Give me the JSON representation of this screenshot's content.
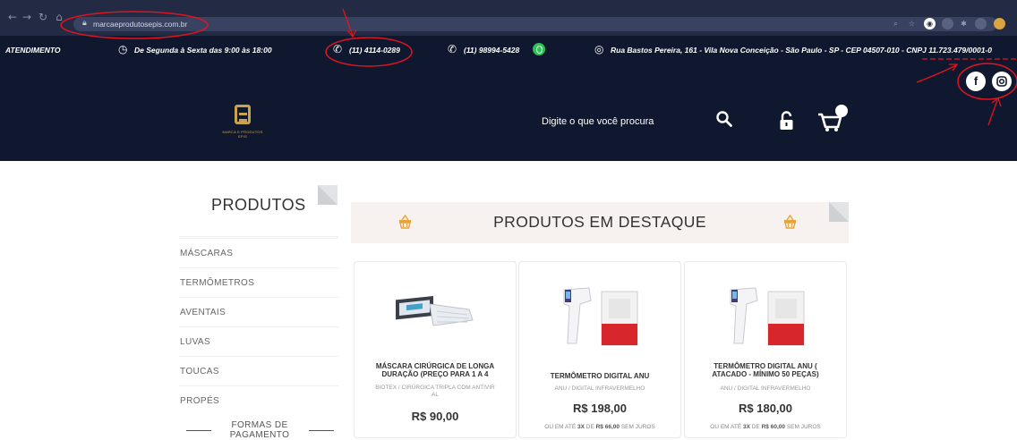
{
  "browser": {
    "url": "marcaeprodutosepis.com.br"
  },
  "infobar": {
    "atendimento_label": "ATENDIMENTO",
    "hours": "De Segunda à Sexta das 9:00 às 18:00",
    "phone1": "(11) 4114-0289",
    "phone2": "(11) 98994-5428",
    "address": "Rua Bastos Pereira, 161 - Vila Nova Conceição - São Paulo - SP - CEP 04507-010 - CNPJ 11.723.479/0001-0"
  },
  "header": {
    "logo_text": "MARCA E PRODUTOS EPIS",
    "search_placeholder": "Digite o que você procura",
    "social": {
      "facebook": "f"
    }
  },
  "sidebar": {
    "title": "PRODUTOS",
    "items": [
      "MÁSCARAS",
      "TERMÔMETROS",
      "AVENTAIS",
      "LUVAS",
      "TOUCAS",
      "PROPÉS"
    ],
    "formas_pagamento_line1": "FORMAS DE",
    "formas_pagamento_line2": "PAGAMENTO"
  },
  "featured": {
    "title": "PRODUTOS EM DESTAQUE"
  },
  "products": [
    {
      "name_line1": "MÁSCARA CIRÚRGICA DE LONGA",
      "name_line2": "DURAÇÃO (PREÇO PARA 1 A 4",
      "category_line1": "BIOTEX / CIRÚRGICA TRIPLA COM ANTIVIR",
      "category_line2": "AL",
      "price": "R$ 90,00"
    },
    {
      "name_line1": "TERMÔMETRO DIGITAL ANU",
      "category_line1": "ANU / DIGITAL INFRAVERMELHO",
      "price": "R$ 198,00",
      "installment_prefix": "OU EM ATÉ",
      "installment_count": "3X",
      "installment_mid": "DE",
      "installment_value": "R$ 66,00",
      "installment_suffix": "SEM JUROS"
    },
    {
      "name_line1": "TERMÔMETRO DIGITAL ANU (",
      "name_line2": "ATACADO - MÍNIMO 50 PEÇAS)",
      "category_line1": "ANU / DIGITAL INFRAVERMELHO",
      "price": "R$ 180,00",
      "installment_prefix": "OU EM ATÉ",
      "installment_count": "3X",
      "installment_mid": "DE",
      "installment_value": "R$ 60,00",
      "installment_suffix": "SEM JUROS"
    }
  ],
  "colors": {
    "header_bg": "#10182f",
    "brand_gold": "#c9a24c",
    "annotation_red": "#e0141e"
  },
  "icons": [
    "back-icon",
    "forward-icon",
    "reload-icon",
    "home-icon",
    "lock-icon",
    "clock-icon",
    "phone-icon",
    "whatsapp-icon",
    "location-icon",
    "search-icon",
    "padlock-icon",
    "cart-icon",
    "facebook-icon",
    "instagram-icon",
    "basket-icon"
  ]
}
